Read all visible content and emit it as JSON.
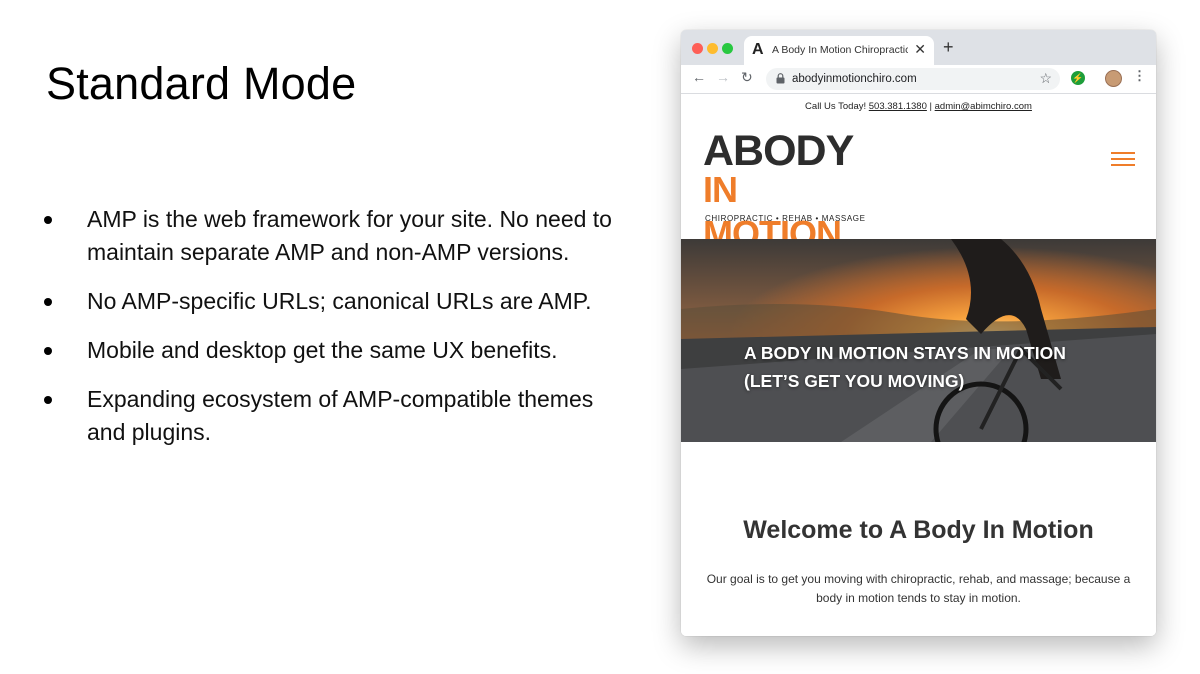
{
  "slide": {
    "title": "Standard Mode",
    "bullets": [
      "AMP is the web framework for your site. No need to maintain separate AMP and non-AMP versions.",
      "No AMP-specific URLs; canonical URLs are AMP.",
      "Mobile and desktop get the same UX benefits.",
      "Expanding ecosystem of AMP-compatible themes and plugins."
    ]
  },
  "browser": {
    "tab_title": "A Body In Motion Chiropractic",
    "tab_favicon": "A",
    "url": "abodyinmotionchiro.com",
    "icons": [
      "back-arrow-icon",
      "forward-arrow-icon",
      "reload-icon",
      "lock-icon",
      "star-icon",
      "extension-icon",
      "avatar",
      "more-menu-icon",
      "close-icon",
      "new-tab-icon"
    ]
  },
  "site": {
    "call_label": "Call Us Today!",
    "phone": "503.381.1380",
    "separator": "|",
    "email": "admin@abimchiro.com",
    "logo_line1": "ABODY",
    "logo_line2": "IN MOTION",
    "logo_tagline": "CHIROPRACTIC  •  REHAB  •  MASSAGE",
    "hero_line1": "A BODY IN MOTION STAYS IN MOTION",
    "hero_line2": "(LET’S GET YOU MOVING)",
    "welcome_heading": "Welcome to A Body In Motion",
    "intro_text": "Our goal is to get you moving with chiropractic, rehab, and massage; because a body in motion tends to stay in motion.",
    "colors": {
      "brand_orange": "#ef7d2a",
      "logo_dark": "#2d2d2d"
    }
  }
}
